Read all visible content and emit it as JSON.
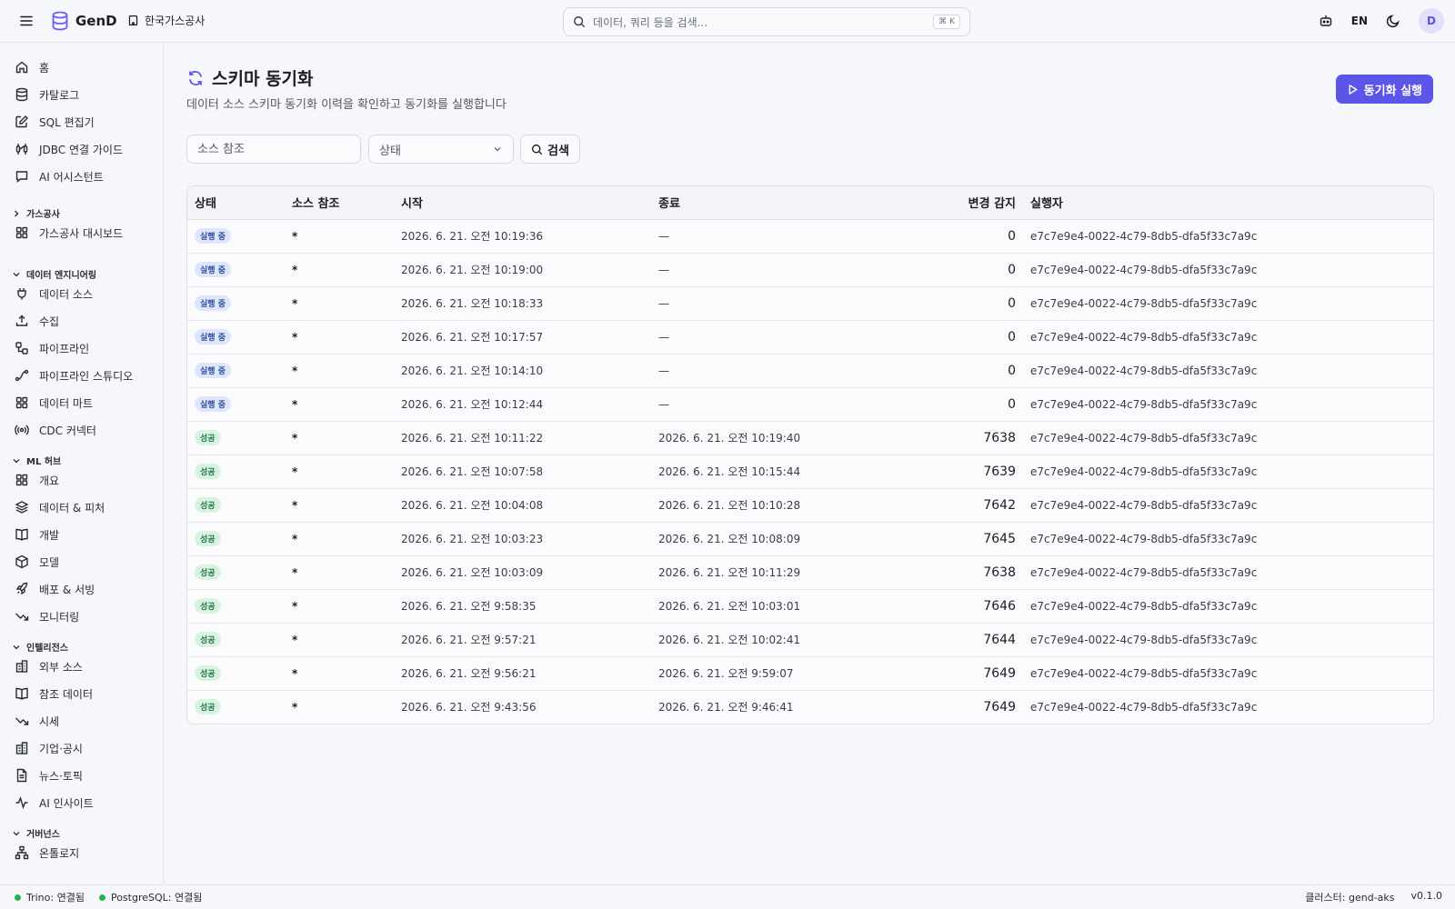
{
  "header": {
    "app_name": "GenD",
    "org_name": "한국가스공사",
    "search_placeholder": "데이터, 쿼리 등을 검색...",
    "search_shortcut": "⌘ K",
    "lang": "EN",
    "avatar_letter": "D"
  },
  "sidebar": {
    "top_items": [
      {
        "label": "홈",
        "icon": "home-icon"
      },
      {
        "label": "카탈로그",
        "icon": "database-icon"
      },
      {
        "label": "SQL 편집기",
        "icon": "edit-icon"
      },
      {
        "label": "JDBC 연결 가이드",
        "icon": "cable-icon"
      },
      {
        "label": "AI 어시스턴트",
        "icon": "chat-icon"
      }
    ],
    "groups": [
      {
        "label": "가스공사",
        "collapsed": true,
        "items": [
          {
            "label": "가스공사 대시보드",
            "icon": "grid-icon"
          }
        ]
      },
      {
        "label": "데이터 엔지니어링",
        "collapsed": false,
        "items": [
          {
            "label": "데이터 소스",
            "icon": "plug-icon"
          },
          {
            "label": "수집",
            "icon": "upload-icon"
          },
          {
            "label": "파이프라인",
            "icon": "workflow-icon"
          },
          {
            "label": "파이프라인 스튜디오",
            "icon": "spline-icon"
          },
          {
            "label": "데이터 마트",
            "icon": "grid-icon"
          },
          {
            "label": "CDC 커넥터",
            "icon": "radio-icon"
          }
        ]
      },
      {
        "label": "ML 허브",
        "collapsed": false,
        "items": [
          {
            "label": "개요",
            "icon": "grid-icon"
          },
          {
            "label": "데이터 & 피처",
            "icon": "layers-icon"
          },
          {
            "label": "개발",
            "icon": "book-icon"
          },
          {
            "label": "모델",
            "icon": "box-icon"
          },
          {
            "label": "배포 & 서빙",
            "icon": "rocket-icon"
          },
          {
            "label": "모니터링",
            "icon": "trend-down-icon"
          }
        ]
      },
      {
        "label": "인텔리전스",
        "collapsed": false,
        "items": [
          {
            "label": "외부 소스",
            "icon": "building-icon"
          },
          {
            "label": "참조 데이터",
            "icon": "book-icon"
          },
          {
            "label": "시세",
            "icon": "trend-down-icon"
          },
          {
            "label": "기업·공시",
            "icon": "building-icon"
          },
          {
            "label": "뉴스·토픽",
            "icon": "file-icon"
          },
          {
            "label": "AI 인사이트",
            "icon": "activity-icon"
          }
        ]
      },
      {
        "label": "거버넌스",
        "collapsed": false,
        "items": [
          {
            "label": "온톨로지",
            "icon": "network-icon"
          }
        ]
      }
    ]
  },
  "page": {
    "title": "스키마 동기화",
    "subtitle": "데이터 소스 스키마 동기화 이력을 확인하고 동기화를 실행합니다",
    "run_button": "동기화 실행",
    "filter_source_placeholder": "소스 참조",
    "filter_status_label": "상태",
    "search_button": "검색"
  },
  "table": {
    "headers": [
      "상태",
      "소스 참조",
      "시작",
      "종료",
      "변경 감지",
      "실행자"
    ],
    "rows": [
      {
        "status": "실행 중",
        "kind": "running",
        "source": "*",
        "start": "2026. 6. 21. 오전 10:19:36",
        "end": "—",
        "changes": "0",
        "by": "e7c7e9e4-0022-4c79-8db5-dfa5f33c7a9c"
      },
      {
        "status": "실행 중",
        "kind": "running",
        "source": "*",
        "start": "2026. 6. 21. 오전 10:19:00",
        "end": "—",
        "changes": "0",
        "by": "e7c7e9e4-0022-4c79-8db5-dfa5f33c7a9c"
      },
      {
        "status": "실행 중",
        "kind": "running",
        "source": "*",
        "start": "2026. 6. 21. 오전 10:18:33",
        "end": "—",
        "changes": "0",
        "by": "e7c7e9e4-0022-4c79-8db5-dfa5f33c7a9c"
      },
      {
        "status": "실행 중",
        "kind": "running",
        "source": "*",
        "start": "2026. 6. 21. 오전 10:17:57",
        "end": "—",
        "changes": "0",
        "by": "e7c7e9e4-0022-4c79-8db5-dfa5f33c7a9c"
      },
      {
        "status": "실행 중",
        "kind": "running",
        "source": "*",
        "start": "2026. 6. 21. 오전 10:14:10",
        "end": "—",
        "changes": "0",
        "by": "e7c7e9e4-0022-4c79-8db5-dfa5f33c7a9c"
      },
      {
        "status": "실행 중",
        "kind": "running",
        "source": "*",
        "start": "2026. 6. 21. 오전 10:12:44",
        "end": "—",
        "changes": "0",
        "by": "e7c7e9e4-0022-4c79-8db5-dfa5f33c7a9c"
      },
      {
        "status": "성공",
        "kind": "success",
        "source": "*",
        "start": "2026. 6. 21. 오전 10:11:22",
        "end": "2026. 6. 21. 오전 10:19:40",
        "changes": "7638",
        "by": "e7c7e9e4-0022-4c79-8db5-dfa5f33c7a9c"
      },
      {
        "status": "성공",
        "kind": "success",
        "source": "*",
        "start": "2026. 6. 21. 오전 10:07:58",
        "end": "2026. 6. 21. 오전 10:15:44",
        "changes": "7639",
        "by": "e7c7e9e4-0022-4c79-8db5-dfa5f33c7a9c"
      },
      {
        "status": "성공",
        "kind": "success",
        "source": "*",
        "start": "2026. 6. 21. 오전 10:04:08",
        "end": "2026. 6. 21. 오전 10:10:28",
        "changes": "7642",
        "by": "e7c7e9e4-0022-4c79-8db5-dfa5f33c7a9c"
      },
      {
        "status": "성공",
        "kind": "success",
        "source": "*",
        "start": "2026. 6. 21. 오전 10:03:23",
        "end": "2026. 6. 21. 오전 10:08:09",
        "changes": "7645",
        "by": "e7c7e9e4-0022-4c79-8db5-dfa5f33c7a9c"
      },
      {
        "status": "성공",
        "kind": "success",
        "source": "*",
        "start": "2026. 6. 21. 오전 10:03:09",
        "end": "2026. 6. 21. 오전 10:11:29",
        "changes": "7638",
        "by": "e7c7e9e4-0022-4c79-8db5-dfa5f33c7a9c"
      },
      {
        "status": "성공",
        "kind": "success",
        "source": "*",
        "start": "2026. 6. 21. 오전 9:58:35",
        "end": "2026. 6. 21. 오전 10:03:01",
        "changes": "7646",
        "by": "e7c7e9e4-0022-4c79-8db5-dfa5f33c7a9c"
      },
      {
        "status": "성공",
        "kind": "success",
        "source": "*",
        "start": "2026. 6. 21. 오전 9:57:21",
        "end": "2026. 6. 21. 오전 10:02:41",
        "changes": "7644",
        "by": "e7c7e9e4-0022-4c79-8db5-dfa5f33c7a9c"
      },
      {
        "status": "성공",
        "kind": "success",
        "source": "*",
        "start": "2026. 6. 21. 오전 9:56:21",
        "end": "2026. 6. 21. 오전 9:59:07",
        "changes": "7649",
        "by": "e7c7e9e4-0022-4c79-8db5-dfa5f33c7a9c"
      },
      {
        "status": "성공",
        "kind": "success",
        "source": "*",
        "start": "2026. 6. 21. 오전 9:43:56",
        "end": "2026. 6. 21. 오전 9:46:41",
        "changes": "7649",
        "by": "e7c7e9e4-0022-4c79-8db5-dfa5f33c7a9c"
      }
    ]
  },
  "footer": {
    "trino": "Trino: 연결됨",
    "postgres": "PostgreSQL: 연결됨",
    "cluster": "클러스터: gend-aks",
    "version": "v0.1.0"
  },
  "colors": {
    "accent": "#5b55e8",
    "connected": "#22b455"
  }
}
